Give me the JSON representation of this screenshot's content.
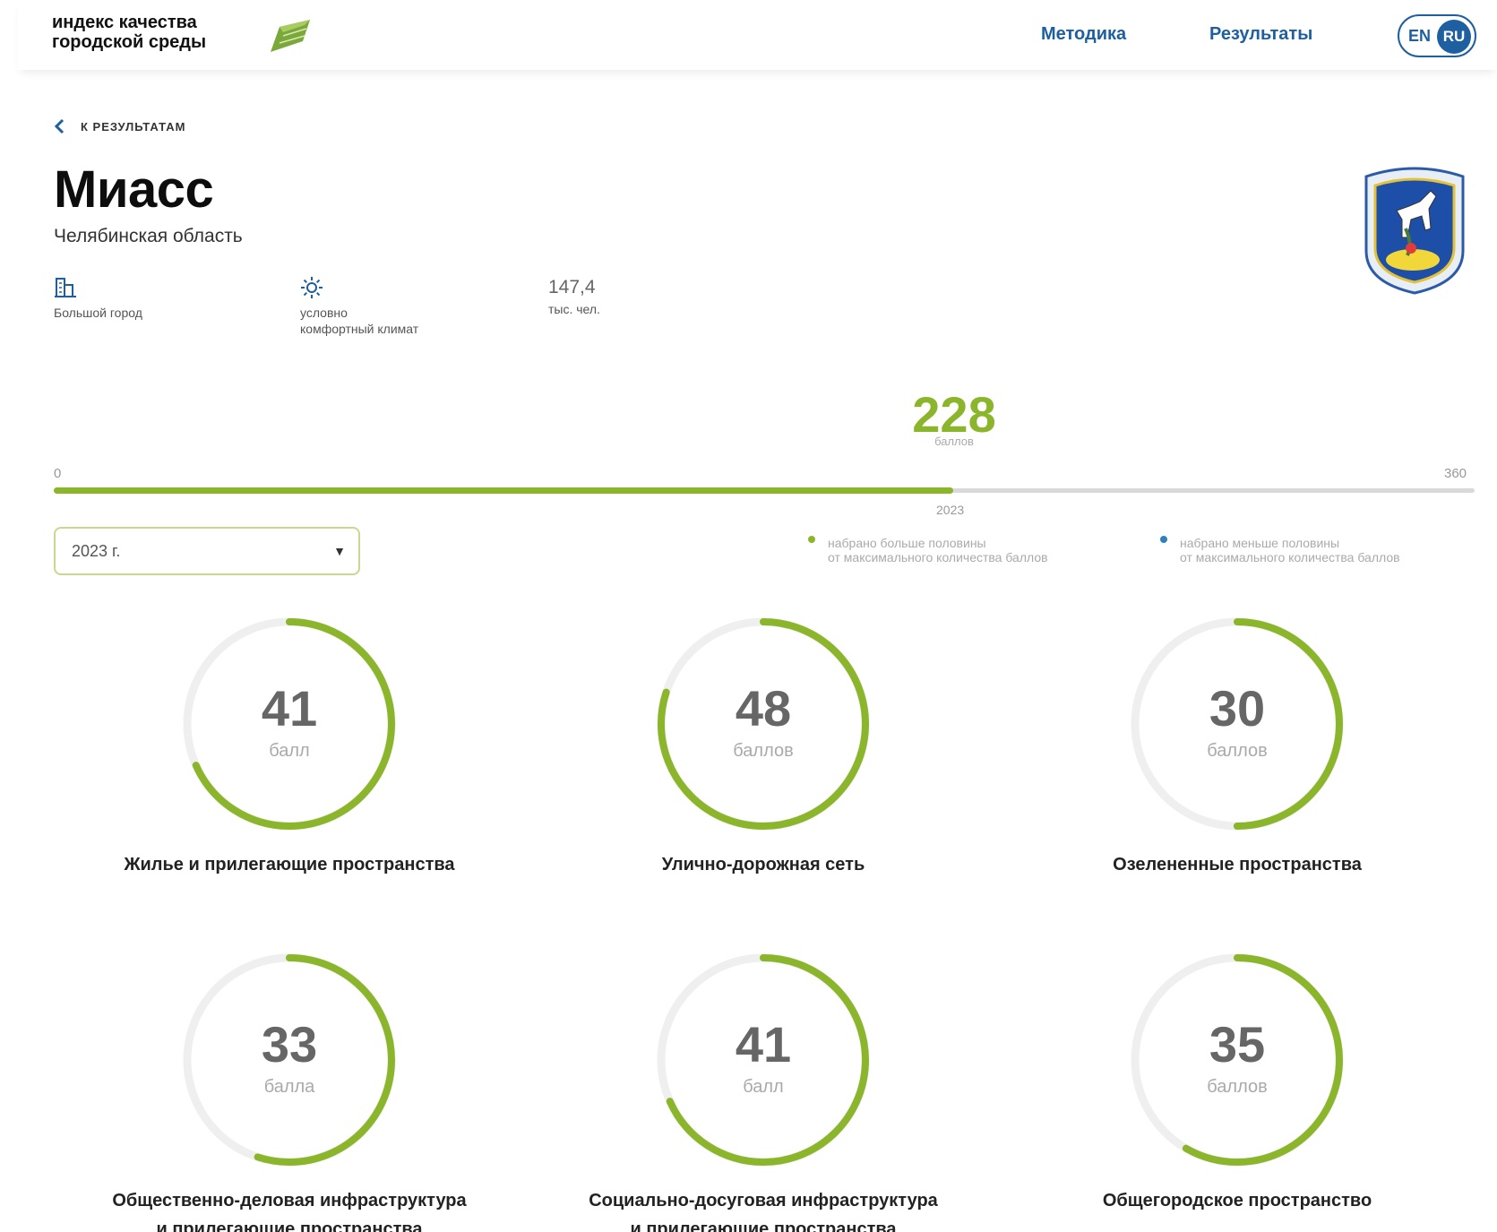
{
  "header": {
    "logo_line1": "индекс качества",
    "logo_line2": "городской среды",
    "nav": [
      "Методика",
      "Результаты"
    ],
    "lang_en": "EN",
    "lang_ru": "RU"
  },
  "back_label": "К РЕЗУЛЬТАТАМ",
  "city": "Миасс",
  "region": "Челябинская область",
  "stats": {
    "size_label": "Большой город",
    "climate_line1": "условно",
    "climate_line2": "комфортный климат",
    "population_value": "147,4",
    "population_unit": "тыс. чел."
  },
  "total": {
    "score": "228",
    "unit": "баллов",
    "min": "0",
    "max": "360",
    "year": "2023"
  },
  "year_select": "2023 г.",
  "legend": [
    {
      "line1": "набрано больше половины",
      "line2": "от максимального количества баллов",
      "color": "#8bb52b"
    },
    {
      "line1": "набрано меньше половины",
      "line2": "от максимального количества баллов",
      "color": "#2f7fc1"
    }
  ],
  "colors": {
    "accent": "#8bb52b",
    "brand": "#1d5fa0"
  },
  "categories": [
    {
      "score": "41",
      "unit": "балл",
      "title1": "Жилье и прилегающие пространства",
      "title2": ""
    },
    {
      "score": "48",
      "unit": "баллов",
      "title1": "Улично-дорожная сеть",
      "title2": ""
    },
    {
      "score": "30",
      "unit": "баллов",
      "title1": "Озелененные пространства",
      "title2": ""
    },
    {
      "score": "33",
      "unit": "балла",
      "title1": "Общественно-деловая инфраструктура",
      "title2": "и прилегающие пространства"
    },
    {
      "score": "41",
      "unit": "балл",
      "title1": "Социально-досуговая инфраструктура",
      "title2": "и прилегающие пространства"
    },
    {
      "score": "35",
      "unit": "баллов",
      "title1": "Общегородское пространство",
      "title2": ""
    }
  ]
}
